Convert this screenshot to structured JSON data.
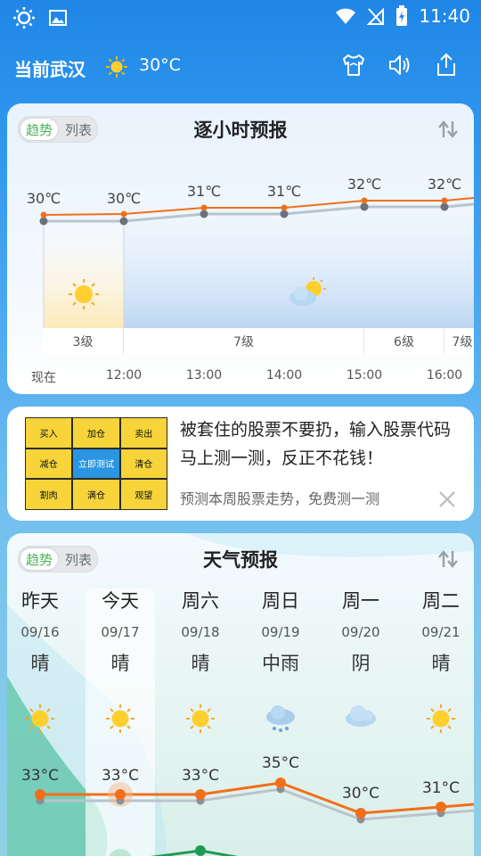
{
  "status_bar": {
    "time": "11:40"
  },
  "header": {
    "location": "当前武汉",
    "temperature": "30°C"
  },
  "hourly": {
    "toggle": {
      "trend": "趋势",
      "list": "列表"
    },
    "title": "逐小时预报",
    "temps": [
      "30℃",
      "30℃",
      "31℃",
      "31℃",
      "32℃",
      "32℃"
    ],
    "temp_values": [
      30,
      30,
      31,
      31,
      32,
      32
    ],
    "times": [
      "现在",
      "12:00",
      "13:00",
      "14:00",
      "15:00",
      "16:00"
    ],
    "wind": [
      "3级",
      "7级",
      "6级",
      "7级"
    ]
  },
  "ad": {
    "grid": [
      "买入",
      "加仓",
      "卖出",
      "减仓",
      "立即测试",
      "清仓",
      "割肉",
      "满仓",
      "观望"
    ],
    "headline": "被套住的股票不要扔，输入股票代码马上测一测，反正不花钱！",
    "subline": "预测本周股票走势，免费测一测"
  },
  "daily": {
    "toggle": {
      "trend": "趋势",
      "list": "列表"
    },
    "title": "天气预报",
    "days": [
      {
        "name": "昨天",
        "date": "09/16",
        "cond": "晴",
        "icon": "sun-icon",
        "high": "33°C"
      },
      {
        "name": "今天",
        "date": "09/17",
        "cond": "晴",
        "icon": "sun-icon",
        "high": "33°C"
      },
      {
        "name": "周六",
        "date": "09/18",
        "cond": "晴",
        "icon": "sun-icon",
        "high": "33°C"
      },
      {
        "name": "周日",
        "date": "09/19",
        "cond": "中雨",
        "icon": "rain-cloud-icon",
        "high": "35°C"
      },
      {
        "name": "周一",
        "date": "09/20",
        "cond": "阴",
        "icon": "cloud-icon",
        "high": "30°C"
      },
      {
        "name": "周二",
        "date": "09/21",
        "cond": "晴",
        "icon": "sun-icon",
        "high": "31°C"
      }
    ],
    "high_values": [
      33,
      33,
      33,
      35,
      30,
      31
    ]
  },
  "colors": {
    "accent_orange": "#f26f1a",
    "accent_green": "#1e9a57",
    "toggle_active": "#4bb35a"
  }
}
